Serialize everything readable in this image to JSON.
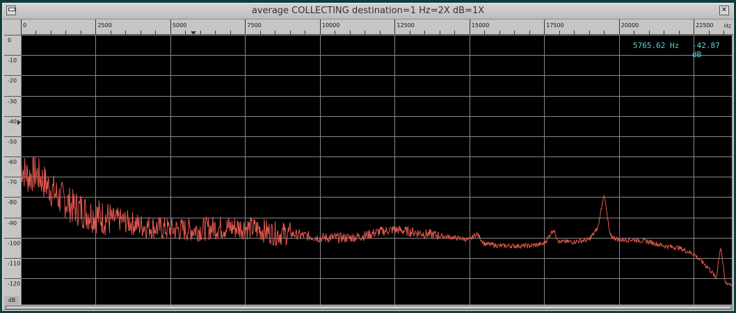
{
  "window": {
    "title": "average COLLECTING destination=1 Hz=2X dB=1X"
  },
  "readout": {
    "frequency": "5765.62 Hz",
    "level": "-42.87 dB"
  },
  "chart_data": {
    "type": "line",
    "xlabel": "Hz",
    "ylabel": "dB",
    "xlim": [
      0,
      23775
    ],
    "ylim": [
      0,
      133
    ],
    "x_ticks": [
      "0",
      "2500",
      "5000",
      "7500",
      "10000",
      "12500",
      "15000",
      "17500",
      "20000",
      "22500"
    ],
    "y_ticks": [
      "0",
      "-10",
      "-20",
      "-30",
      "-40",
      "-50",
      "-60",
      "-70",
      "-80",
      "-90",
      "-100",
      "-110",
      "-120"
    ],
    "grid": true,
    "cursor_hz": 5765.62,
    "series": [
      {
        "color": "#e45a50",
        "x": [
          0,
          250,
          500,
          750,
          1000,
          1250,
          1500,
          1750,
          2000,
          2250,
          2500,
          2750,
          3000,
          3250,
          3500,
          3750,
          4000,
          4500,
          5000,
          5500,
          6000,
          6500,
          7000,
          7500,
          8000,
          8500,
          9000,
          9500,
          10000,
          10500,
          11000,
          11500,
          12000,
          12500,
          13000,
          13500,
          14000,
          14500,
          15000,
          15250,
          15500,
          16000,
          16500,
          17000,
          17500,
          17800,
          18000,
          18500,
          19000,
          19300,
          19500,
          19700,
          20000,
          20500,
          21000,
          21500,
          22000,
          22500,
          23000,
          23250,
          23400,
          23550,
          23775
        ],
        "y": [
          -65,
          -70,
          -68,
          -72,
          -76,
          -80,
          -82,
          -85,
          -86,
          -88,
          -89,
          -90,
          -91,
          -91,
          -92,
          -93,
          -94,
          -95,
          -96,
          -96,
          -96,
          -95,
          -95,
          -95,
          -96,
          -98,
          -98,
          -99,
          -100,
          -100,
          -100,
          -99,
          -97,
          -96,
          -97,
          -98,
          -99,
          -100,
          -101,
          -98,
          -103,
          -104,
          -104,
          -104,
          -103,
          -96,
          -102,
          -102,
          -101,
          -95,
          -78,
          -99,
          -101,
          -101,
          -102,
          -104,
          -105,
          -108,
          -115,
          -120,
          -104,
          -122,
          -123
        ]
      }
    ]
  }
}
